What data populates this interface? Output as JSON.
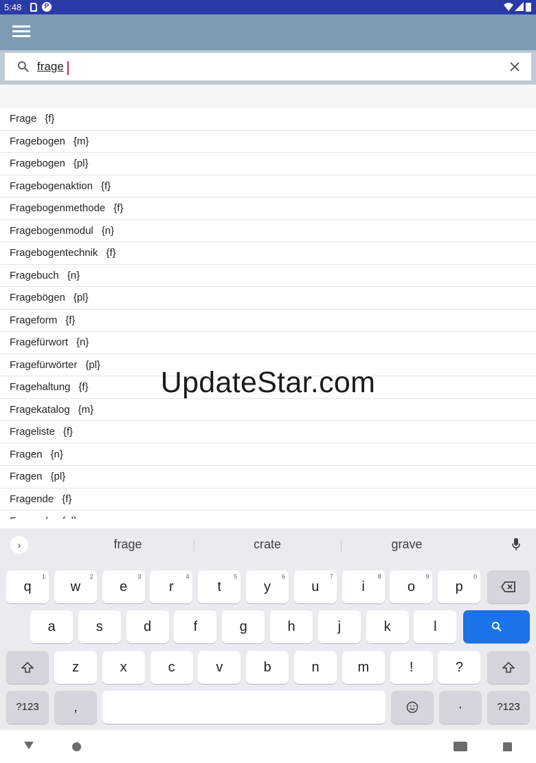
{
  "status_bar": {
    "time": "5:48",
    "icons": [
      "sd-card-icon",
      "notification-icon",
      "wifi-icon",
      "cell-signal-icon",
      "battery-icon"
    ]
  },
  "app_bar": {
    "menu_icon": "hamburger-menu-icon",
    "color": "#7f9bb4"
  },
  "search": {
    "query": "frage",
    "icon": "search-icon",
    "clear_icon": "close-icon"
  },
  "results": [
    {
      "word": "Frage",
      "gender": "{f}"
    },
    {
      "word": "Fragebogen",
      "gender": "{m}"
    },
    {
      "word": "Fragebogen",
      "gender": "{pl}"
    },
    {
      "word": "Fragebogenaktion",
      "gender": "{f}"
    },
    {
      "word": "Fragebogenmethode",
      "gender": "{f}"
    },
    {
      "word": "Fragebogenmodul",
      "gender": "{n}"
    },
    {
      "word": "Fragebogentechnik",
      "gender": "{f}"
    },
    {
      "word": "Fragebuch",
      "gender": "{n}"
    },
    {
      "word": "Fragebögen",
      "gender": "{pl}"
    },
    {
      "word": "Frageform",
      "gender": "{f}"
    },
    {
      "word": "Fragefürwort",
      "gender": "{n}"
    },
    {
      "word": "Fragefürwörter",
      "gender": "{pl}"
    },
    {
      "word": "Fragehaltung",
      "gender": "{f}"
    },
    {
      "word": "Fragekatalog",
      "gender": "{m}"
    },
    {
      "word": "Frageliste",
      "gender": "{f}"
    },
    {
      "word": "Fragen",
      "gender": "{n}"
    },
    {
      "word": "Fragen",
      "gender": "{pl}"
    },
    {
      "word": "Fragende",
      "gender": "{f}"
    },
    {
      "word": "Fragende",
      "gender": "{pl}"
    }
  ],
  "watermark": "UpdateStar.com",
  "keyboard": {
    "suggestions": [
      "frage",
      "crate",
      "grave"
    ],
    "row1": [
      {
        "k": "q",
        "h": "1"
      },
      {
        "k": "w",
        "h": "2"
      },
      {
        "k": "e",
        "h": "3"
      },
      {
        "k": "r",
        "h": "4"
      },
      {
        "k": "t",
        "h": "5"
      },
      {
        "k": "y",
        "h": "6"
      },
      {
        "k": "u",
        "h": "7"
      },
      {
        "k": "i",
        "h": "8"
      },
      {
        "k": "o",
        "h": "9"
      },
      {
        "k": "p",
        "h": "0"
      }
    ],
    "row2": [
      "a",
      "s",
      "d",
      "f",
      "g",
      "h",
      "j",
      "k",
      "l"
    ],
    "row3": [
      "z",
      "x",
      "c",
      "v",
      "b",
      "n",
      "m",
      "!",
      "?"
    ],
    "symbols_label": "?123",
    "comma_label": ",",
    "period_label": "·",
    "accent": "#1a73e8"
  },
  "nav_bar": {
    "icons": [
      "back-icon",
      "home-icon",
      "keyboard-icon",
      "recents-icon"
    ]
  }
}
